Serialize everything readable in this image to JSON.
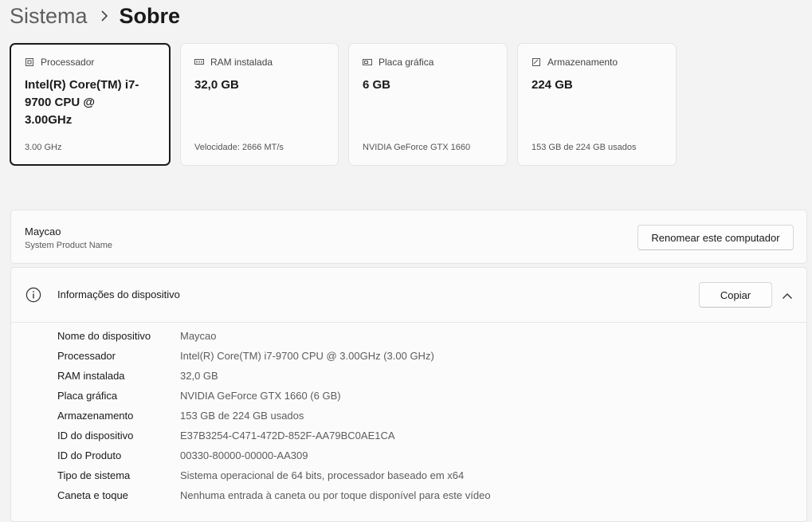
{
  "breadcrumb": {
    "parent": "Sistema",
    "current": "Sobre"
  },
  "cards": [
    {
      "icon": "processor-chip-icon",
      "title": "Processador",
      "value": "Intel(R) Core(TM) i7-9700 CPU @ 3.00GHz",
      "sub": "3.00 GHz",
      "selected": true
    },
    {
      "icon": "ram-icon",
      "title": "RAM instalada",
      "value": "32,0 GB",
      "sub": "Velocidade: 2666 MT/s"
    },
    {
      "icon": "graphics-card-icon",
      "title": "Placa gráfica",
      "value": "6 GB",
      "sub": "NVIDIA GeForce GTX 1660"
    },
    {
      "icon": "storage-drive-icon",
      "title": "Armazenamento",
      "value": "224 GB",
      "sub": "153 GB de 224 GB usados"
    }
  ],
  "product": {
    "name": "Maycao",
    "sub": "System Product Name",
    "rename_label": "Renomear este computador"
  },
  "device_info": {
    "title": "Informações do dispositivo",
    "copy_label": "Copiar",
    "rows": [
      {
        "label": "Nome do dispositivo",
        "value": "Maycao"
      },
      {
        "label": "Processador",
        "value": "Intel(R) Core(TM) i7-9700 CPU @ 3.00GHz (3.00 GHz)"
      },
      {
        "label": "RAM instalada",
        "value": "32,0 GB"
      },
      {
        "label": "Placa gráfica",
        "value": "NVIDIA GeForce GTX 1660 (6 GB)"
      },
      {
        "label": "Armazenamento",
        "value": "153 GB de 224 GB usados"
      },
      {
        "label": "ID do dispositivo",
        "value": "E37B3254-C471-472D-852F-AA79BC0AE1CA"
      },
      {
        "label": "ID do Produto",
        "value": "00330-80000-00000-AA309"
      },
      {
        "label": "Tipo de sistema",
        "value": "Sistema operacional de 64 bits, processador baseado em x64"
      },
      {
        "label": "Caneta e toque",
        "value": "Nenhuma entrada à caneta ou por toque disponível para este vídeo"
      }
    ]
  }
}
